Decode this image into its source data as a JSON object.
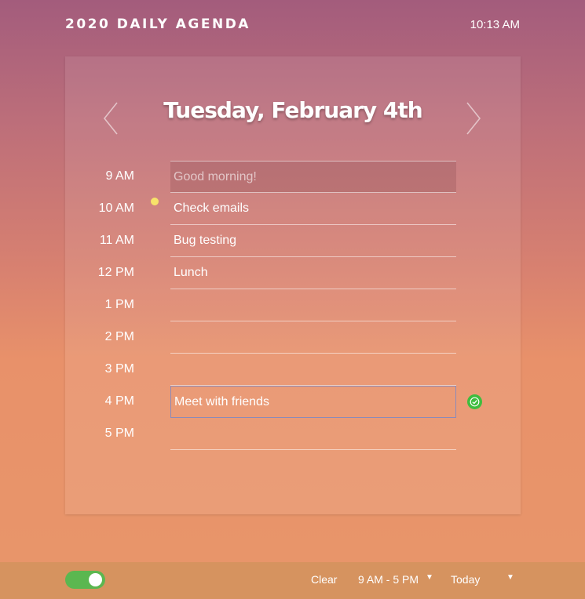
{
  "header": {
    "title": "2020 DAILY AGENDA",
    "clock": "10:13 AM"
  },
  "card": {
    "date_title": "Tuesday, February 4th",
    "hours": [
      {
        "time": "9 AM",
        "text": "Good morning!"
      },
      {
        "time": "10 AM",
        "text": "Check emails"
      },
      {
        "time": "11 AM",
        "text": "Bug testing"
      },
      {
        "time": "12 PM",
        "text": "Lunch"
      },
      {
        "time": "1 PM",
        "text": ""
      },
      {
        "time": "2 PM",
        "text": ""
      },
      {
        "time": "3 PM",
        "text": ""
      },
      {
        "time": "4 PM",
        "text": "Meet with friends"
      },
      {
        "time": "5 PM",
        "text": ""
      }
    ]
  },
  "footer": {
    "toggle_on": true,
    "clear_label": "Clear",
    "range_label": "9 AM - 5 PM",
    "day_label": "Today",
    "caret": "▼"
  },
  "colors": {
    "accent_save": "#3fbd3f",
    "now_indicator": "#f7e36a",
    "toggle_on": "#5bb750"
  }
}
